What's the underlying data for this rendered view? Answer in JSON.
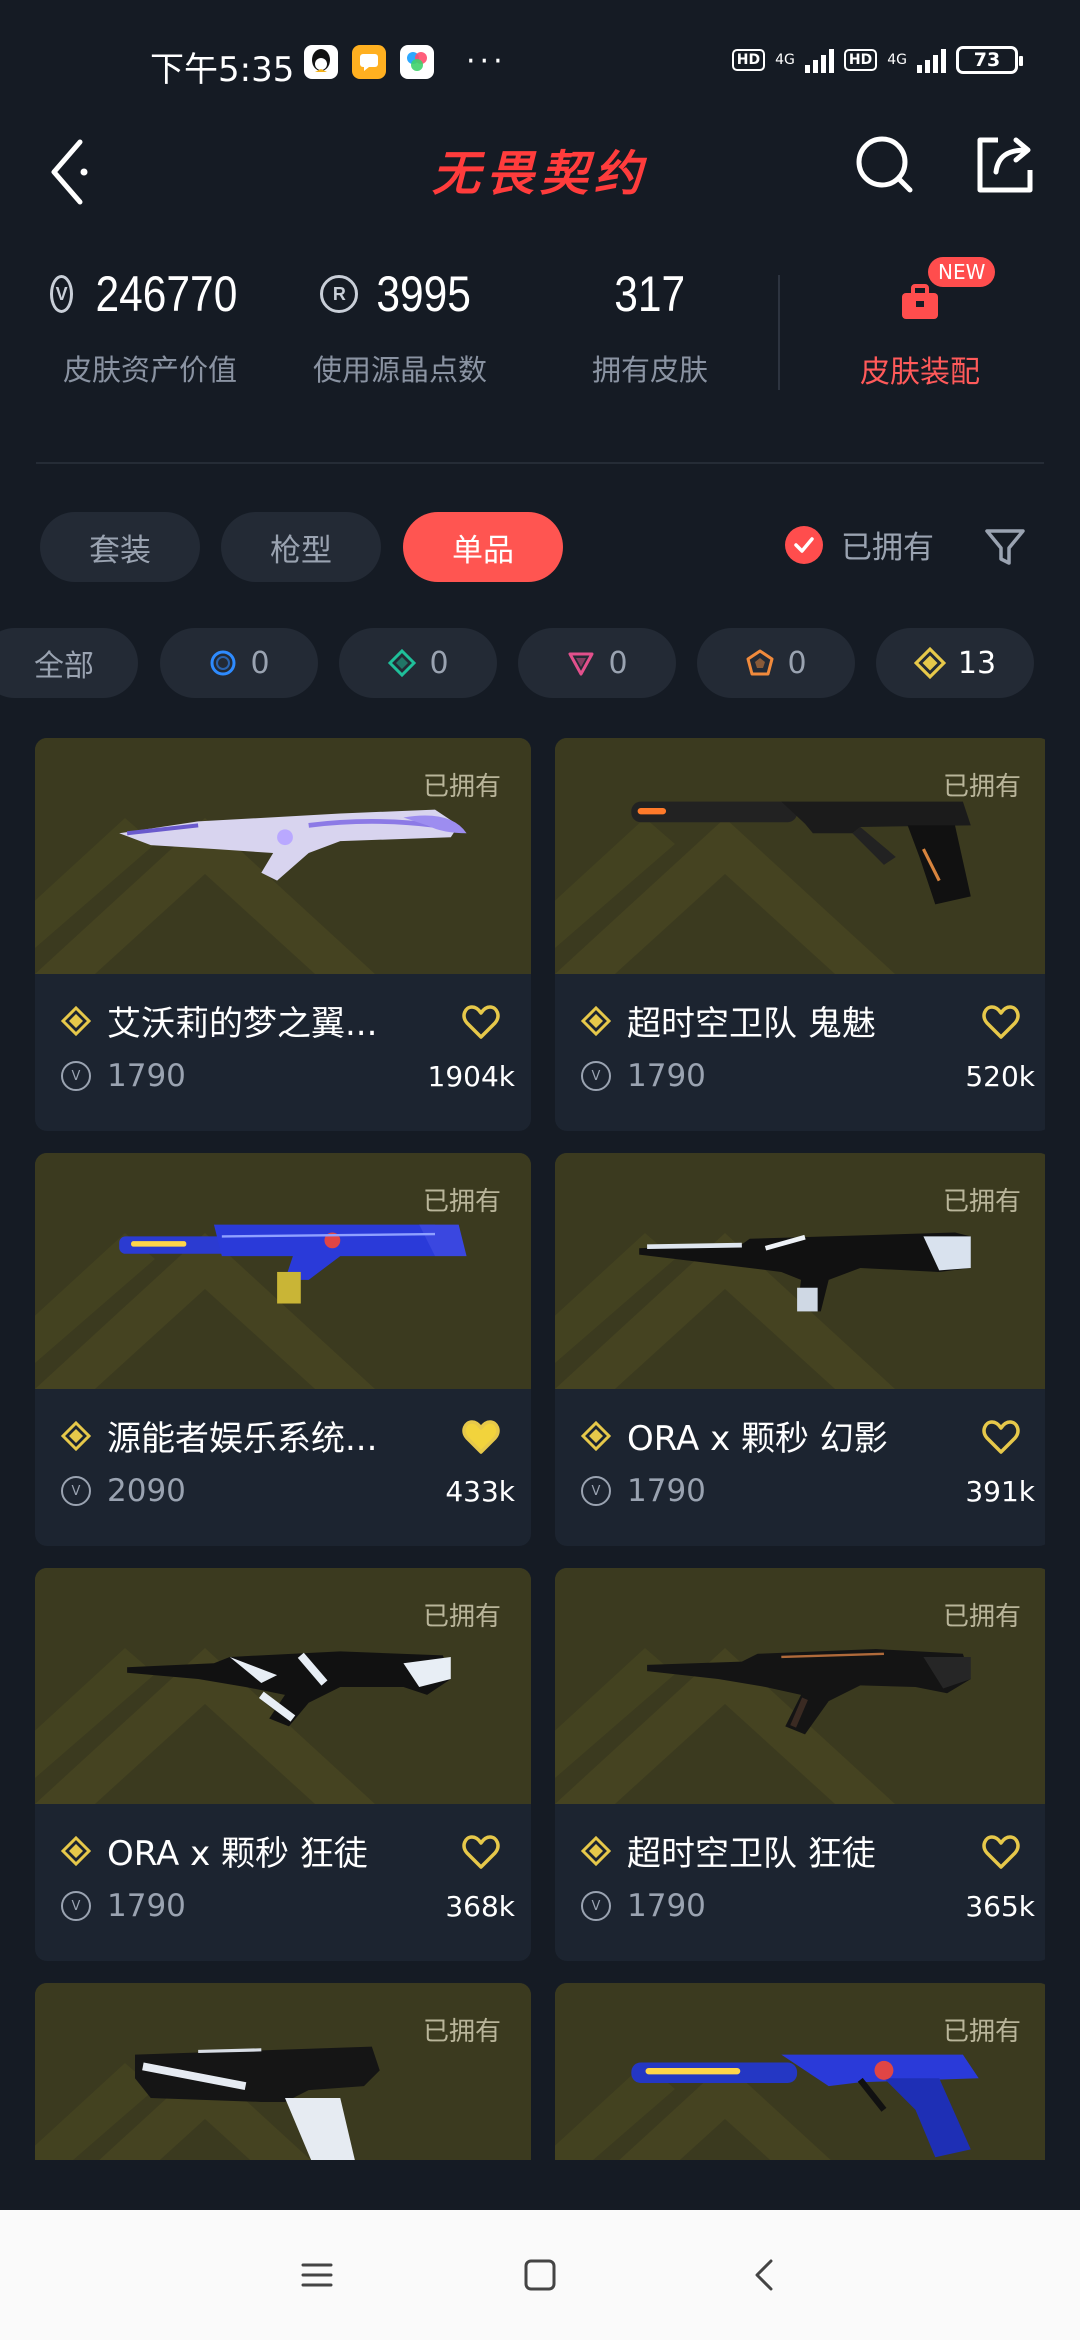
{
  "status_bar": {
    "time": "下午5:35",
    "dots": "···",
    "hd1": "HD",
    "net1": "4G",
    "hd2": "HD",
    "net2": "4G",
    "battery": "73",
    "apps": [
      {
        "icon": "qq-icon",
        "color": "#ffffff"
      },
      {
        "icon": "message-app-icon",
        "color": "#ffb020"
      },
      {
        "icon": "photos-app-icon",
        "color": "#ffffff"
      }
    ]
  },
  "header": {
    "logo_text": "无畏契约",
    "back_icon": "back-arrow-icon",
    "search_icon": "search-icon",
    "share_icon": "share-icon"
  },
  "stats": {
    "asset_value": "246770",
    "asset_label": "皮肤资产价值",
    "radianite_value": "3995",
    "radianite_label": "使用源晶点数",
    "owned_value": "317",
    "owned_label": "拥有皮肤",
    "loadout_label": "皮肤装配",
    "new_badge": "NEW"
  },
  "tabs": [
    {
      "label": "套装",
      "active": false
    },
    {
      "label": "枪型",
      "active": false
    },
    {
      "label": "单品",
      "active": true
    }
  ],
  "filter": {
    "owned_label": "已拥有",
    "filter_icon": "filter-icon"
  },
  "tiers": [
    {
      "label": "全部",
      "count": "",
      "color": "#9aa3b1",
      "icon": ""
    },
    {
      "label": "",
      "count": "0",
      "color": "#2e8bff",
      "icon": "select-tier-icon"
    },
    {
      "label": "",
      "count": "0",
      "color": "#1fbf9a",
      "icon": "deluxe-tier-icon"
    },
    {
      "label": "",
      "count": "0",
      "color": "#e2508c",
      "icon": "premium-tier-icon"
    },
    {
      "label": "",
      "count": "0",
      "color": "#f08a3c",
      "icon": "ultra-tier-icon"
    },
    {
      "label": "",
      "count": "13",
      "color": "#e6c84a",
      "icon": "exclusive-tier-icon"
    }
  ],
  "cards": [
    {
      "name": "艾沃莉的梦之翼...",
      "price": "1790",
      "likes": "1904k",
      "owned": "已拥有",
      "liked": false,
      "weapon": "wing-rifle"
    },
    {
      "name": "超时空卫队 鬼魅",
      "price": "1790",
      "likes": "520k",
      "owned": "已拥有",
      "liked": false,
      "weapon": "ghost-pistol"
    },
    {
      "name": "源能者娱乐系统...",
      "price": "2090",
      "likes": "433k",
      "owned": "已拥有",
      "liked": true,
      "weapon": "blue-smg"
    },
    {
      "name": "ORA x 颗秒 幻影",
      "price": "1790",
      "likes": "391k",
      "owned": "已拥有",
      "liked": false,
      "weapon": "phantom"
    },
    {
      "name": "ORA x 颗秒 狂徒",
      "price": "1790",
      "likes": "368k",
      "owned": "已拥有",
      "liked": false,
      "weapon": "vandal-white"
    },
    {
      "name": "超时空卫队 狂徒",
      "price": "1790",
      "likes": "365k",
      "owned": "已拥有",
      "liked": false,
      "weapon": "vandal-dark"
    },
    {
      "name": "",
      "price": "",
      "likes": "",
      "owned": "已拥有",
      "liked": false,
      "weapon": "white-pistol"
    },
    {
      "name": "",
      "price": "",
      "likes": "",
      "owned": "已拥有",
      "liked": false,
      "weapon": "blue-pistol"
    }
  ],
  "nav_bar": {
    "menu_icon": "menu-icon",
    "home_icon": "home-icon",
    "back_icon": "back-icon"
  }
}
